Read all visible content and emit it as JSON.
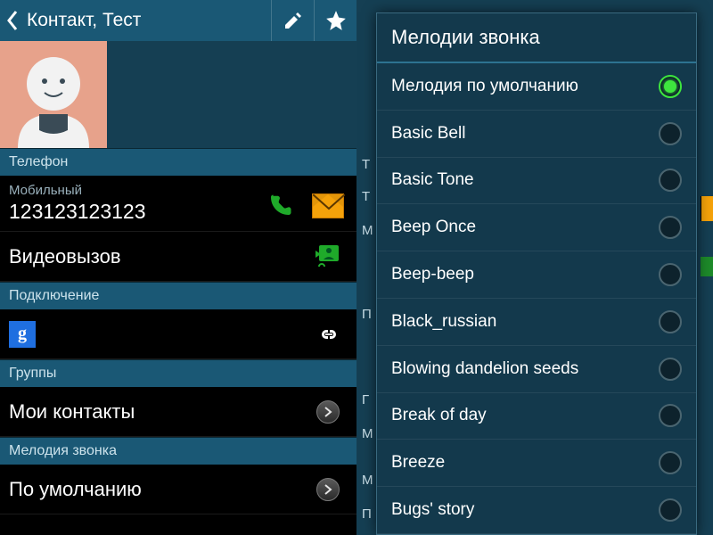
{
  "left": {
    "header": {
      "title": "Контакт, Тест"
    },
    "sections": {
      "phone_header": "Телефон",
      "phone_type": "Мобильный",
      "phone_number": "123123123123",
      "video_call": "Видеовызов",
      "connection_header": "Подключение",
      "groups_header": "Группы",
      "groups_value": "Мои контакты",
      "ringtone_header": "Мелодия звонка",
      "ringtone_value": "По умолчанию"
    }
  },
  "right": {
    "dialog_title": "Мелодии звонка",
    "ringtones": [
      {
        "label": "Мелодия по умолчанию",
        "selected": true
      },
      {
        "label": "Basic Bell",
        "selected": false
      },
      {
        "label": "Basic Tone",
        "selected": false
      },
      {
        "label": "Beep Once",
        "selected": false
      },
      {
        "label": "Beep-beep",
        "selected": false
      },
      {
        "label": "Black_russian",
        "selected": false
      },
      {
        "label": "Blowing dandelion seeds",
        "selected": false
      },
      {
        "label": "Break of day",
        "selected": false
      },
      {
        "label": "Breeze",
        "selected": false
      },
      {
        "label": "Bugs' story",
        "selected": false
      }
    ],
    "bg_peek_labels": [
      "Т",
      "Т",
      "М",
      "П",
      "Г",
      "М",
      "М",
      "П"
    ]
  }
}
